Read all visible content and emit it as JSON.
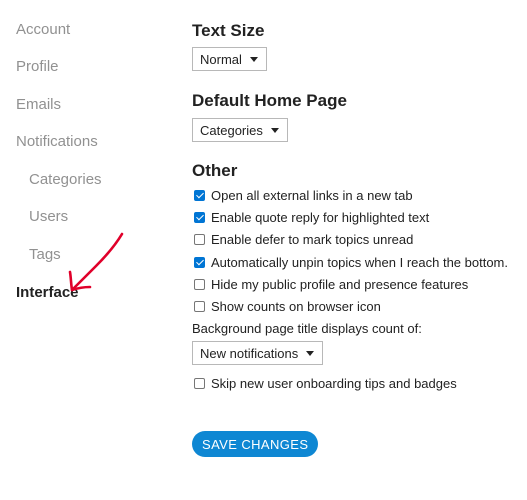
{
  "sidebar": {
    "items": [
      {
        "label": "Account"
      },
      {
        "label": "Profile"
      },
      {
        "label": "Emails"
      },
      {
        "label": "Notifications"
      },
      {
        "label": "Categories"
      },
      {
        "label": "Users"
      },
      {
        "label": "Tags"
      },
      {
        "label": "Interface"
      }
    ],
    "active": "Interface"
  },
  "text_size": {
    "heading": "Text Size",
    "value": "Normal"
  },
  "home_page": {
    "heading": "Default Home Page",
    "value": "Categories"
  },
  "other": {
    "heading": "Other",
    "options": [
      {
        "label": "Open all external links in a new tab",
        "checked": true
      },
      {
        "label": "Enable quote reply for highlighted text",
        "checked": true
      },
      {
        "label": "Enable defer to mark topics unread",
        "checked": false
      },
      {
        "label": "Automatically unpin topics when I reach the bottom.",
        "checked": true
      },
      {
        "label": "Hide my public profile and presence features",
        "checked": false
      },
      {
        "label": "Show counts on browser icon",
        "checked": false
      }
    ],
    "title_count_label": "Background page title displays count of:",
    "title_count_value": "New notifications",
    "skip_onboarding": {
      "label": "Skip new user onboarding tips and badges",
      "checked": false
    }
  },
  "save_label": "SAVE CHANGES",
  "colors": {
    "accent": "#0e87d3",
    "checkbox": "#0075d4",
    "annotation": "#e0002a",
    "muted": "#919191"
  }
}
